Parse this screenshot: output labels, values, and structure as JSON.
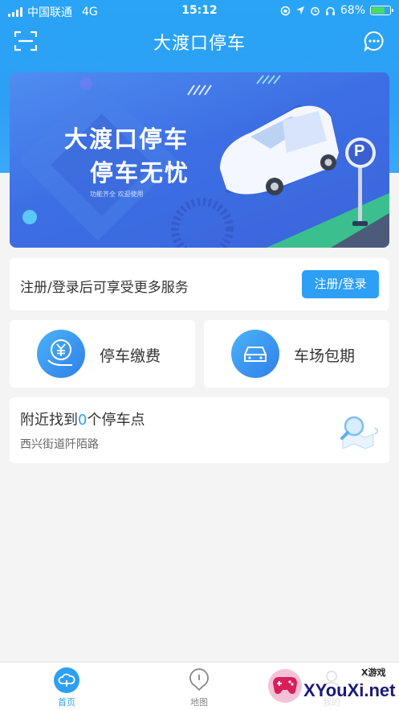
{
  "status_bar": {
    "carrier": "中国联通",
    "network": "4G",
    "time": "15:12",
    "battery": "68%"
  },
  "nav": {
    "title": "大渡口停车",
    "left_icon": "scan-icon",
    "right_icon": "message-icon"
  },
  "banner": {
    "line1": "大渡口停车",
    "line2": "停车无忧",
    "tagline": "功能齐全 欢迎使用",
    "sign_letter": "P"
  },
  "login": {
    "prompt": "注册/登录后可享受更多服务",
    "button": "注册/登录"
  },
  "functions": [
    {
      "label": "停车缴费",
      "icon": "yuan-coin-icon"
    },
    {
      "label": "车场包期",
      "icon": "car-icon"
    }
  ],
  "nearby": {
    "prefix": "附近找到",
    "count": "0",
    "suffix": "个停车点",
    "address": "西兴街道阡陌路"
  },
  "tabs": [
    {
      "label": "首页",
      "icon": "home-cloud-icon",
      "active": true
    },
    {
      "label": "地图",
      "icon": "map-pin-icon",
      "active": false
    },
    {
      "label": "我的",
      "icon": "user-icon",
      "active": false
    }
  ],
  "watermark": {
    "sub": "X游戏",
    "main": "XYouXi.net"
  },
  "colors": {
    "primary": "#2d9ff5",
    "banner": "#3d6fe4",
    "background": "#f4f4f4"
  }
}
